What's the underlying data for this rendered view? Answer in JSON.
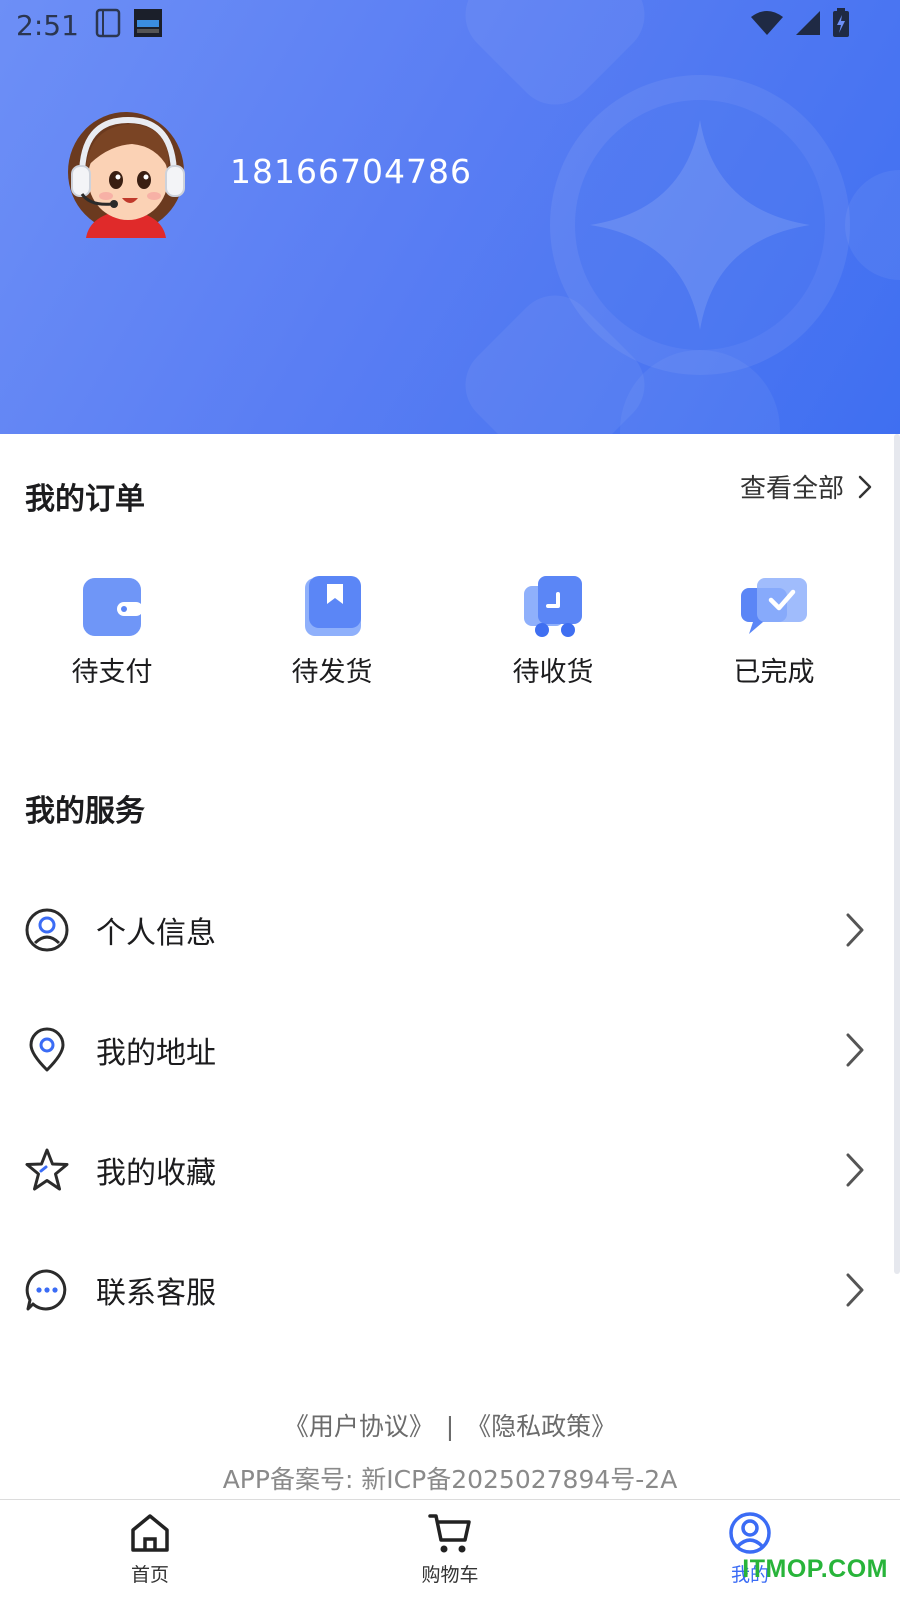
{
  "status_bar": {
    "time": "2:51",
    "icons": [
      "notebook-icon",
      "calendar-widget-icon",
      "wifi-icon",
      "signal-icon",
      "battery-charging-icon"
    ]
  },
  "header": {
    "phone": "18166704786",
    "avatar_icon": "customer-service-avatar"
  },
  "orders": {
    "title": "我的订单",
    "view_all": "查看全部",
    "items": [
      {
        "label": "待支付",
        "icon": "wallet-icon"
      },
      {
        "label": "待发货",
        "icon": "package-bookmark-icon"
      },
      {
        "label": "待收货",
        "icon": "delivery-truck-icon"
      },
      {
        "label": "已完成",
        "icon": "completed-check-icon"
      }
    ]
  },
  "services": {
    "title": "我的服务",
    "items": [
      {
        "label": "个人信息",
        "icon": "user-circle-icon"
      },
      {
        "label": "我的地址",
        "icon": "location-pin-icon"
      },
      {
        "label": "我的收藏",
        "icon": "star-icon"
      },
      {
        "label": "联系客服",
        "icon": "chat-bubble-icon"
      }
    ]
  },
  "footer": {
    "user_agreement": "《用户协议》",
    "separator": "|",
    "privacy_policy": "《隐私政策》",
    "icp": "APP备案号: 新ICP备2025027894号-2A"
  },
  "tab_bar": {
    "tabs": [
      {
        "label": "首页",
        "icon": "home-icon",
        "active": false
      },
      {
        "label": "购物车",
        "icon": "cart-icon",
        "active": false
      },
      {
        "label": "我的",
        "icon": "profile-icon",
        "active": true
      }
    ]
  },
  "watermark": "ITMOP.COM",
  "colors": {
    "header_start": "#6d8ff6",
    "header_end": "#3f6ff1",
    "accent": "#3b6cf5",
    "watermark": "#28b43a"
  }
}
